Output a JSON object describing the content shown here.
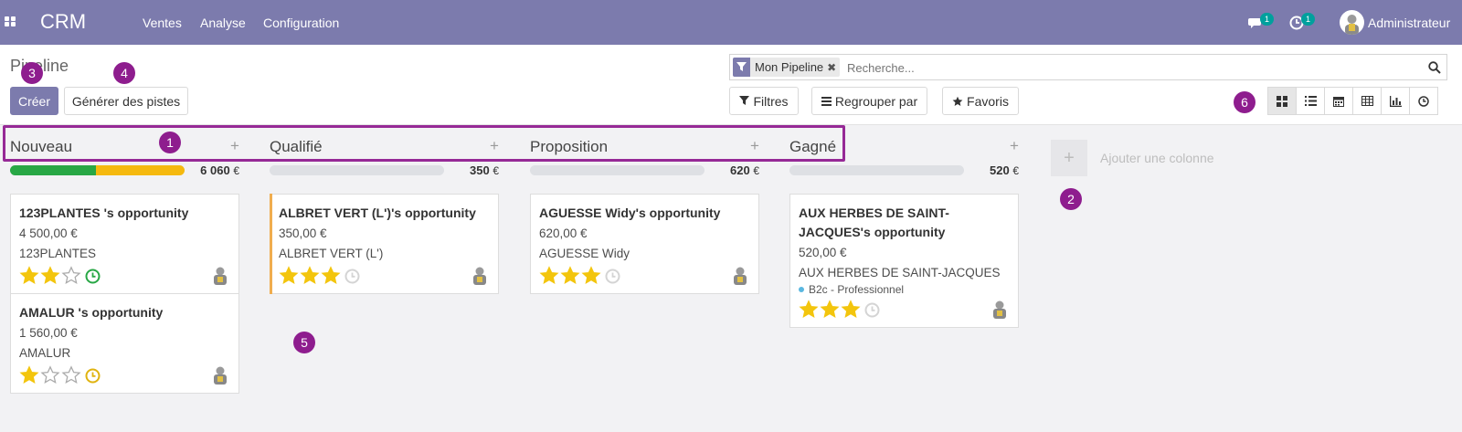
{
  "navbar": {
    "app_name": "CRM",
    "menus": [
      "Ventes",
      "Analyse",
      "Configuration"
    ],
    "messages_count": "1",
    "activities_count": "1",
    "user_name": "Administrateur",
    "colors": {
      "bar": "#7c7bad",
      "badge": "#00a09d"
    }
  },
  "control_panel": {
    "breadcrumb": "Pipeline",
    "create_label": "Créer",
    "generate_label": "Générer des pistes",
    "search_facet": "Mon Pipeline",
    "search_placeholder": "Recherche...",
    "filters_label": "Filtres",
    "groupby_label": "Regrouper par",
    "favorites_label": "Favoris",
    "views": [
      "kanban-icon",
      "list-icon",
      "calendar-icon",
      "pivot-icon",
      "graph-icon",
      "activity-icon"
    ],
    "active_view": "kanban"
  },
  "callouts": [
    "1",
    "2",
    "3",
    "4",
    "5",
    "6"
  ],
  "add_column_label": "Ajouter une colonne",
  "columns": [
    {
      "title": "Nouveau",
      "total": "6 060",
      "currency": "€",
      "progress": {
        "green": 0.49,
        "orange": 0.51
      }
    },
    {
      "title": "Qualifié",
      "total": "350",
      "currency": "€",
      "progress": {
        "green": 0,
        "orange": 0
      }
    },
    {
      "title": "Proposition",
      "total": "620",
      "currency": "€",
      "progress": {
        "green": 0,
        "orange": 0
      }
    },
    {
      "title": "Gagné",
      "total": "520",
      "currency": "€",
      "progress": {
        "green": 0,
        "orange": 0
      }
    }
  ],
  "cards": {
    "c1": {
      "title": "123PLANTES 's opportunity",
      "amount": "4 500,00 €",
      "customer": "123PLANTES",
      "stars": 2,
      "activity_color": "#28a745"
    },
    "c2": {
      "title": "AMALUR 's opportunity",
      "amount": "1 560,00 €",
      "customer": "AMALUR",
      "stars": 1,
      "activity_color": "#e0b30f"
    },
    "c3": {
      "title": "ALBRET VERT (L')'s opportunity",
      "amount": "350,00 €",
      "customer": "ALBRET VERT (L')",
      "stars": 3,
      "activity_color": "#d4d4d4",
      "bar_color": "#f0ad4e"
    },
    "c4": {
      "title": "AGUESSE Widy's opportunity",
      "amount": "620,00 €",
      "customer": "AGUESSE Widy",
      "stars": 3,
      "activity_color": "#d4d4d4"
    },
    "c5": {
      "title": "AUX HERBES DE SAINT-JACQUES's opportunity",
      "amount": "520,00 €",
      "customer": "AUX HERBES DE SAINT-JACQUES",
      "tag": "B2c - Professionnel",
      "stars": 3,
      "activity_color": "#d4d4d4"
    }
  },
  "colors": {
    "star": "#f3c50d",
    "star_empty": "#aaaaaa",
    "green": "#28a745",
    "orange": "#f5b90f",
    "callout": "#8e1d8e"
  }
}
